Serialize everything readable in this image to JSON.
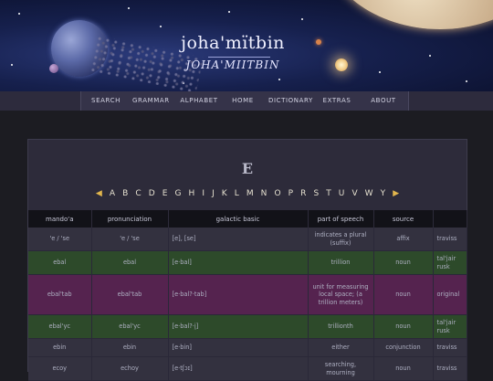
{
  "site": {
    "title": "joha'mïtbin",
    "subtitle": "JOHA'MIITBIN"
  },
  "nav": [
    {
      "label": "SEARCH"
    },
    {
      "label": "GRAMMAR"
    },
    {
      "label": "ALPHABET"
    },
    {
      "label": "HOME"
    },
    {
      "label": "DICTIONARY"
    },
    {
      "label": "EXTRAS"
    },
    {
      "label": "ABOUT"
    }
  ],
  "page": {
    "letter": "E",
    "prev_arrow": "◀",
    "next_arrow": "▶",
    "alphabet": [
      "A",
      "B",
      "C",
      "D",
      "E",
      "G",
      "H",
      "I",
      "J",
      "K",
      "L",
      "M",
      "N",
      "O",
      "P",
      "R",
      "S",
      "T",
      "U",
      "V",
      "W",
      "Y"
    ]
  },
  "table": {
    "headers": [
      "mando'a",
      "pronunciation",
      "galactic basic",
      "part of speech",
      "source",
      ""
    ],
    "rows": [
      {
        "style": "plain",
        "mando": "'e / 'se",
        "pron": "'e / 'se",
        "ipa": "[e], [se]",
        "basic": "indicates a plural (suffix)",
        "pos": "affix",
        "source": "traviss"
      },
      {
        "style": "green",
        "mando": "ebal",
        "pron": "ebal",
        "ipa": "[e·bal]",
        "basic": "trillion",
        "pos": "noun",
        "source": "tal'jair rusk"
      },
      {
        "style": "purple",
        "mando": "ebal'tab",
        "pron": "ebal'tab",
        "ipa": "[e·bal?·tab]",
        "basic": "unit for measuring local space; (a trillion meters)",
        "pos": "noun",
        "source": "original"
      },
      {
        "style": "green",
        "mando": "ebal'yc",
        "pron": "ebal'yc",
        "ipa": "[e·bal?·i̯]",
        "basic": "trillionth",
        "pos": "noun",
        "source": "tal'jair rusk"
      },
      {
        "style": "plain",
        "mando": "ebin",
        "pron": "ebin",
        "ipa": "[e·bin]",
        "basic": "either",
        "pos": "conjunction",
        "source": "traviss"
      },
      {
        "style": "plain",
        "mando": "ecoy",
        "pron": "echoy",
        "ipa": "[e·tʃɔɪ]",
        "basic": "searching, mourning",
        "pos": "noun",
        "source": "traviss"
      }
    ]
  },
  "colors": {
    "row_plain": "#33313f",
    "row_green": "#2d4a2a",
    "row_purple": "#55234f",
    "arrow": "#e2b64d"
  }
}
